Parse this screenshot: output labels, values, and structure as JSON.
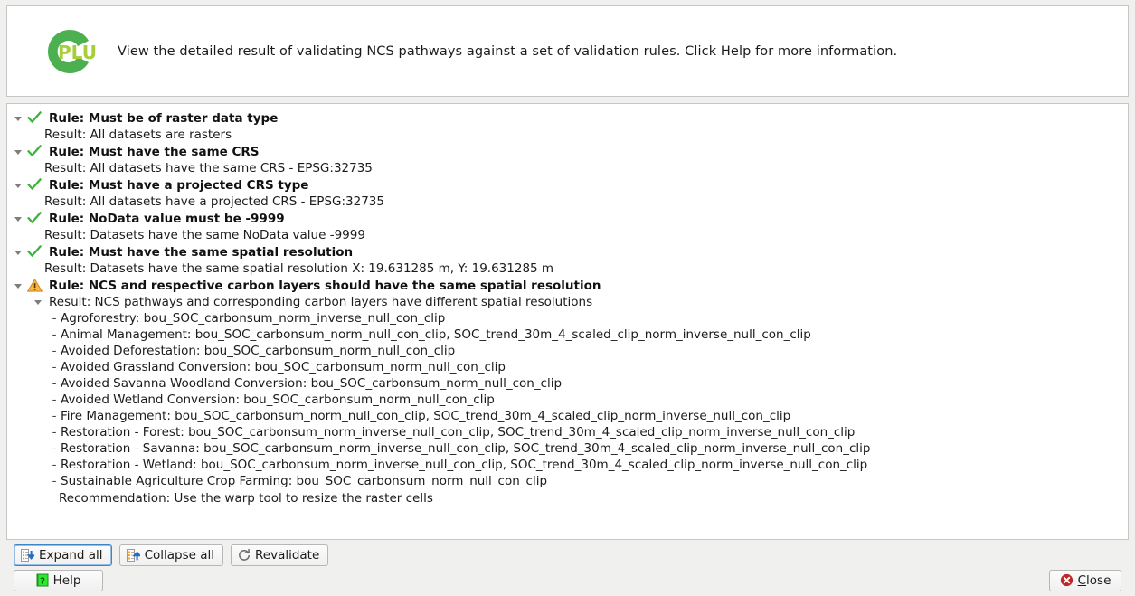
{
  "header": {
    "logo_name": "cplus-logo",
    "logo_text": "PLUS",
    "description": "View the detailed result of validating NCS pathways against a set of validation rules. Click Help for more information."
  },
  "colors": {
    "logo_ring": "#4CAF50",
    "logo_text": "#A6CE39",
    "check": "#3DB33D",
    "warning": "#F0A430",
    "close_icon": "#C0262A",
    "help_icon": "#20C020",
    "focus": "#3E85C6"
  },
  "results": [
    {
      "status": "pass",
      "rule": "Rule: Must be of raster data type",
      "result": "Result: All datasets are rasters"
    },
    {
      "status": "pass",
      "rule": "Rule: Must have the same CRS",
      "result": "Result: All datasets have the same CRS - EPSG:32735"
    },
    {
      "status": "pass",
      "rule": "Rule: Must have a projected CRS type",
      "result": "Result: All datasets have a projected CRS - EPSG:32735"
    },
    {
      "status": "pass",
      "rule": "Rule: NoData value must be -9999",
      "result": "Result: Datasets have the same NoData value -9999"
    },
    {
      "status": "pass",
      "rule": "Rule: Must have the same spatial resolution",
      "result": "Result: Datasets have the same spatial resolution X: 19.631285 m, Y: 19.631285 m"
    },
    {
      "status": "warning",
      "rule": "Rule: NCS and respective carbon layers should have the same spatial resolution",
      "result": "Result: NCS pathways and corresponding carbon layers have different spatial resolutions",
      "details": [
        "Agroforestry: bou_SOC_carbonsum_norm_inverse_null_con_clip",
        "Animal Management: bou_SOC_carbonsum_norm_null_con_clip, SOC_trend_30m_4_scaled_clip_norm_inverse_null_con_clip",
        "Avoided Deforestation: bou_SOC_carbonsum_norm_null_con_clip",
        "Avoided Grassland Conversion: bou_SOC_carbonsum_norm_null_con_clip",
        "Avoided Savanna Woodland Conversion: bou_SOC_carbonsum_norm_null_con_clip",
        "Avoided Wetland Conversion: bou_SOC_carbonsum_norm_null_con_clip",
        "Fire Management: bou_SOC_carbonsum_norm_null_con_clip, SOC_trend_30m_4_scaled_clip_norm_inverse_null_con_clip",
        "Restoration - Forest: bou_SOC_carbonsum_norm_inverse_null_con_clip, SOC_trend_30m_4_scaled_clip_norm_inverse_null_con_clip",
        "Restoration - Savanna: bou_SOC_carbonsum_norm_inverse_null_con_clip, SOC_trend_30m_4_scaled_clip_norm_inverse_null_con_clip",
        "Restoration - Wetland: bou_SOC_carbonsum_norm_inverse_null_con_clip, SOC_trend_30m_4_scaled_clip_norm_inverse_null_con_clip",
        "Sustainable Agriculture Crop Farming: bou_SOC_carbonsum_norm_null_con_clip"
      ],
      "recommendation": "Recommendation: Use the warp tool to resize the raster cells"
    }
  ],
  "toolbar": {
    "expand_all": "Expand all",
    "collapse_all": "Collapse all",
    "revalidate": "Revalidate",
    "help": "Help"
  },
  "footer": {
    "close_mnemonic": "C",
    "close_rest": "lose"
  }
}
